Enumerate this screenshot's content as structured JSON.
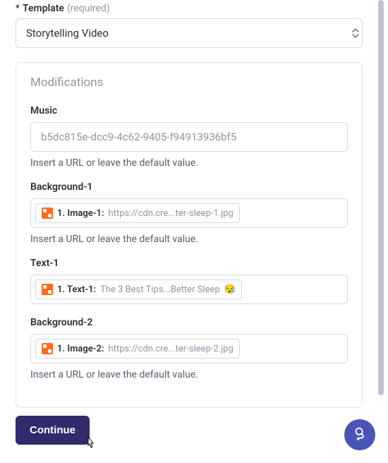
{
  "template": {
    "asterisk": "*",
    "label": "Template",
    "required": "(required)",
    "value": "Storytelling Video"
  },
  "modifications": {
    "title": "Modifications",
    "hint_url": "Insert a URL or leave the default value.",
    "fields": {
      "music": {
        "label": "Music",
        "placeholder": "b5dc815e-dcc9-4c62-9405-f94913936bf5"
      },
      "bg1": {
        "label": "Background-1",
        "chip_key": "1. Image-1:",
        "chip_val": "https://cdn.cre...ter-sleep-1.jpg"
      },
      "text1": {
        "label": "Text-1",
        "chip_key": "1. Text-1:",
        "chip_val": "The 3 Best Tips...Better Sleep",
        "emoji": "😪"
      },
      "bg2": {
        "label": "Background-2",
        "chip_key": "1. Image-2:",
        "chip_val": "https://cdn.cre...ter-sleep-2.jpg"
      }
    }
  },
  "footer": {
    "continue_label": "Continue"
  }
}
